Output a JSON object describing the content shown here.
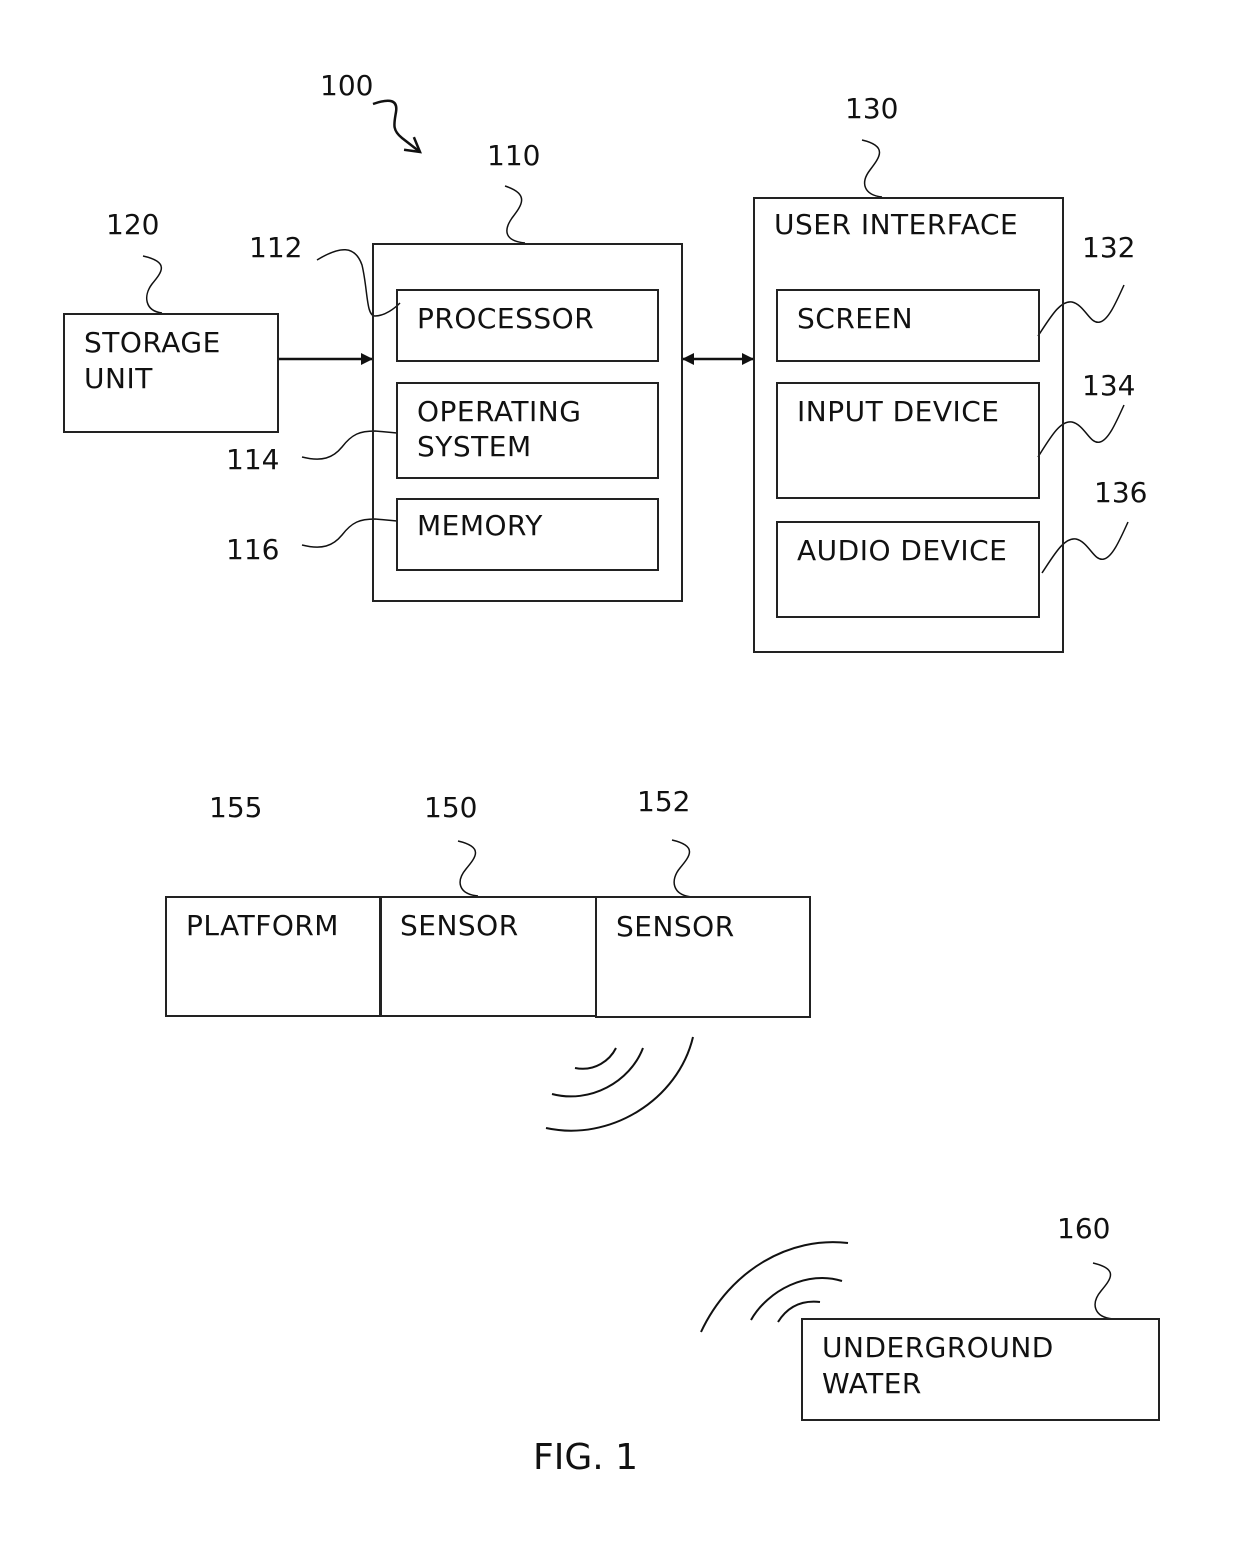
{
  "figure": {
    "caption": "FIG. 1",
    "system_ref": "100"
  },
  "computer": {
    "ref": "110",
    "components": [
      {
        "ref": "112",
        "label": "PROCESSOR"
      },
      {
        "ref": "114",
        "label": "OPERATING\nSYSTEM"
      },
      {
        "ref": "116",
        "label": "MEMORY"
      }
    ]
  },
  "storage": {
    "ref": "120",
    "label": "STORAGE\nUNIT"
  },
  "user_interface": {
    "ref": "130",
    "label": "USER INTERFACE",
    "components": [
      {
        "ref": "132",
        "label": "SCREEN"
      },
      {
        "ref": "134",
        "label": "INPUT DEVICE"
      },
      {
        "ref": "136",
        "label": "AUDIO DEVICE"
      }
    ]
  },
  "platform_assembly": {
    "platform": {
      "ref": "155",
      "label": "PLATFORM"
    },
    "sensor_1": {
      "ref": "150",
      "label": "SENSOR"
    },
    "sensor_2": {
      "ref": "152",
      "label": "SENSOR"
    }
  },
  "target": {
    "ref": "160",
    "label": "UNDERGROUND\nWATER"
  },
  "connections": [
    {
      "from": "storage",
      "to": "computer",
      "type": "one-way-arrow"
    },
    {
      "from": "computer",
      "to": "user_interface",
      "type": "two-way-arrow"
    }
  ]
}
